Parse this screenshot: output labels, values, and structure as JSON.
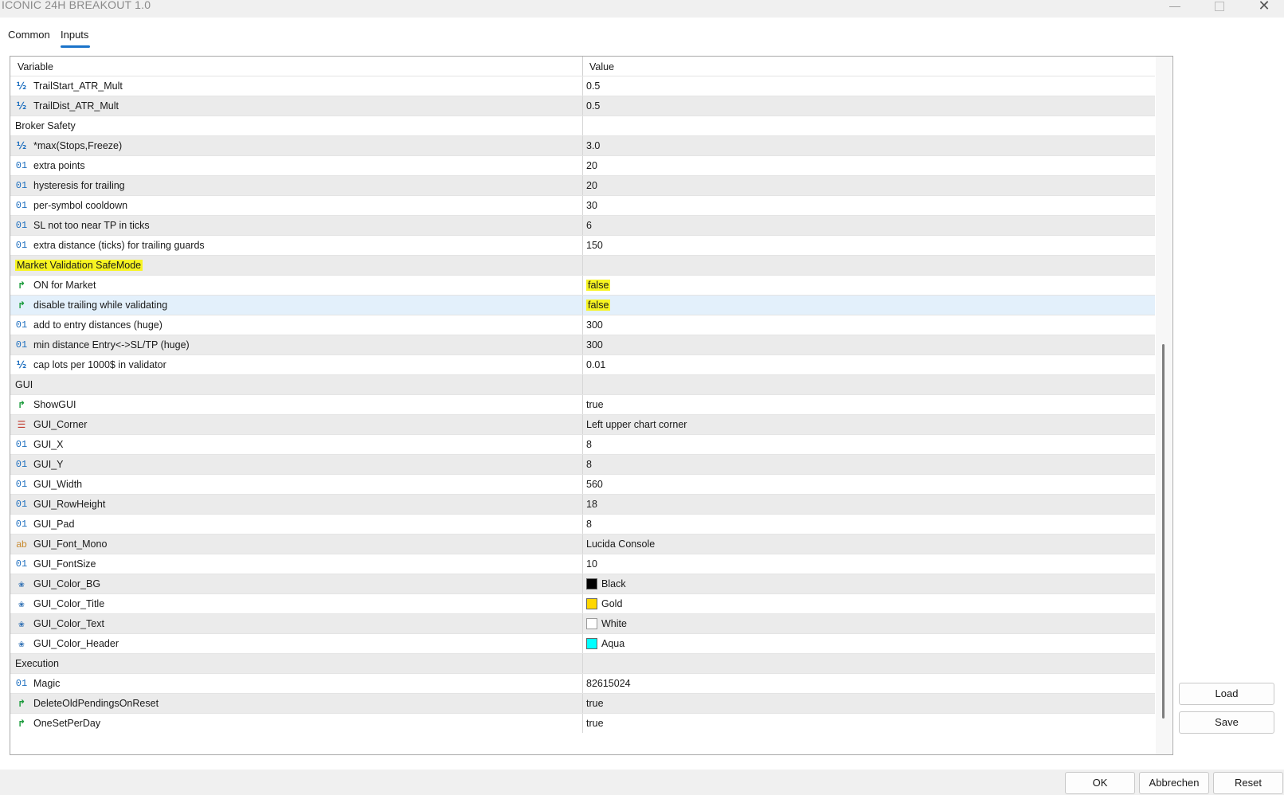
{
  "window": {
    "title": "ICONIC 24H BREAKOUT 1.0"
  },
  "tabs": [
    {
      "label": "Common"
    },
    {
      "label": "Inputs"
    }
  ],
  "grid": {
    "columns": {
      "variable": "Variable",
      "value": "Value"
    },
    "rows": [
      {
        "icon": "half-icon",
        "name": "TrailStart_ATR_Mult",
        "value": "0.5"
      },
      {
        "icon": "half-icon",
        "name": "TrailDist_ATR_Mult",
        "value": "0.5"
      },
      {
        "group": true,
        "name": "Broker Safety",
        "value": ""
      },
      {
        "icon": "half-icon",
        "name": "*max(Stops,Freeze)",
        "value": "3.0"
      },
      {
        "icon": "int-icon",
        "name": "extra points",
        "value": "20"
      },
      {
        "icon": "int-icon",
        "name": "hysteresis for trailing",
        "value": "20"
      },
      {
        "icon": "int-icon",
        "name": "per-symbol cooldown",
        "value": "30"
      },
      {
        "icon": "int-icon",
        "name": "SL not too near TP in ticks",
        "value": "6"
      },
      {
        "icon": "int-icon",
        "name": "extra distance (ticks) for trailing guards",
        "value": "150"
      },
      {
        "group": true,
        "name": "Market Validation SafeMode",
        "value": "",
        "highlight_name": true
      },
      {
        "icon": "bool-icon",
        "name": "ON for Market",
        "value": "false",
        "highlight_value": true
      },
      {
        "icon": "bool-icon",
        "name": "disable trailing while validating",
        "value": "false",
        "highlight_value": true,
        "selected": true
      },
      {
        "icon": "int-icon",
        "name": "add to entry distances (huge)",
        "value": "300"
      },
      {
        "icon": "int-icon",
        "name": "min distance Entry<->SL/TP (huge)",
        "value": "300"
      },
      {
        "icon": "half-icon",
        "name": "cap lots per 1000$ in validator",
        "value": "0.01"
      },
      {
        "group": true,
        "name": "GUI",
        "value": ""
      },
      {
        "icon": "bool-icon",
        "name": "ShowGUI",
        "value": "true"
      },
      {
        "icon": "enum-icon",
        "name": "GUI_Corner",
        "value": "Left upper chart corner"
      },
      {
        "icon": "int-icon",
        "name": "GUI_X",
        "value": "8"
      },
      {
        "icon": "int-icon",
        "name": "GUI_Y",
        "value": "8"
      },
      {
        "icon": "int-icon",
        "name": "GUI_Width",
        "value": "560"
      },
      {
        "icon": "int-icon",
        "name": "GUI_RowHeight",
        "value": "18"
      },
      {
        "icon": "int-icon",
        "name": "GUI_Pad",
        "value": "8"
      },
      {
        "icon": "string-icon",
        "name": "GUI_Font_Mono",
        "value": "Lucida Console"
      },
      {
        "icon": "int-icon",
        "name": "GUI_FontSize",
        "value": "10"
      },
      {
        "icon": "color-icon",
        "name": "GUI_Color_BG",
        "value": "Black",
        "swatch": "#000000"
      },
      {
        "icon": "color-icon",
        "name": "GUI_Color_Title",
        "value": "Gold",
        "swatch": "#ffd700"
      },
      {
        "icon": "color-icon",
        "name": "GUI_Color_Text",
        "value": "White",
        "swatch": "#ffffff"
      },
      {
        "icon": "color-icon",
        "name": "GUI_Color_Header",
        "value": "Aqua",
        "swatch": "#00ffff"
      },
      {
        "group": true,
        "name": "Execution",
        "value": ""
      },
      {
        "icon": "int-icon",
        "name": "Magic",
        "value": "82615024"
      },
      {
        "icon": "bool-icon",
        "name": "DeleteOldPendingsOnReset",
        "value": "true"
      },
      {
        "icon": "bool-icon",
        "name": "OneSetPerDay",
        "value": "true"
      }
    ]
  },
  "side_buttons": {
    "load": "Load",
    "save": "Save"
  },
  "footer": {
    "ok": "OK",
    "cancel": "Abbrechen",
    "reset": "Reset"
  },
  "icon_glyphs": {
    "half-icon": "½",
    "int-icon": "01",
    "bool-icon": "↱",
    "string-icon": "ab",
    "enum-icon": "☰",
    "color-icon": "❀"
  }
}
